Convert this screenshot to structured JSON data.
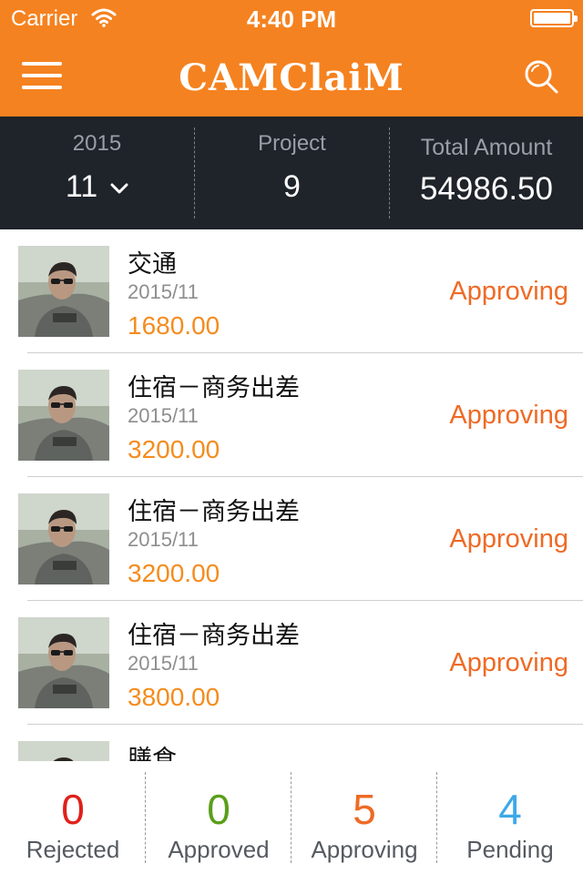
{
  "status_bar": {
    "carrier": "Carrier",
    "time": "4:40 PM"
  },
  "nav": {
    "logo": "CAMClaiM"
  },
  "summary": {
    "year": "2015",
    "month": "11",
    "project_label": "Project",
    "project_count": "9",
    "total_label": "Total Amount",
    "total_value": "54986.50"
  },
  "items": [
    {
      "title": "交通",
      "date": "2015/11",
      "amount": "1680.00",
      "status": "Approving"
    },
    {
      "title": "住宿－商务出差",
      "date": "2015/11",
      "amount": "3200.00",
      "status": "Approving"
    },
    {
      "title": "住宿－商务出差",
      "date": "2015/11",
      "amount": "3200.00",
      "status": "Approving"
    },
    {
      "title": "住宿－商务出差",
      "date": "2015/11",
      "amount": "3800.00",
      "status": "Approving"
    },
    {
      "title": "膳食",
      "date": "",
      "amount": "",
      "status": ""
    }
  ],
  "tabs": [
    {
      "count": "0",
      "label": "Rejected",
      "color": "#e0201a"
    },
    {
      "count": "0",
      "label": "Approved",
      "color": "#5a9e1a"
    },
    {
      "count": "5",
      "label": "Approving",
      "color": "#ef6a25"
    },
    {
      "count": "4",
      "label": "Pending",
      "color": "#3ea8e8"
    }
  ],
  "colors": {
    "brand": "#f58220",
    "summary_bg": "#1f232a",
    "amount": "#f58c1e",
    "approving": "#ef6a25"
  },
  "icons": {
    "menu": "hamburger-icon",
    "search": "search-icon",
    "dropdown": "chevron-down-icon",
    "wifi": "wifi-icon",
    "battery": "battery-icon"
  }
}
